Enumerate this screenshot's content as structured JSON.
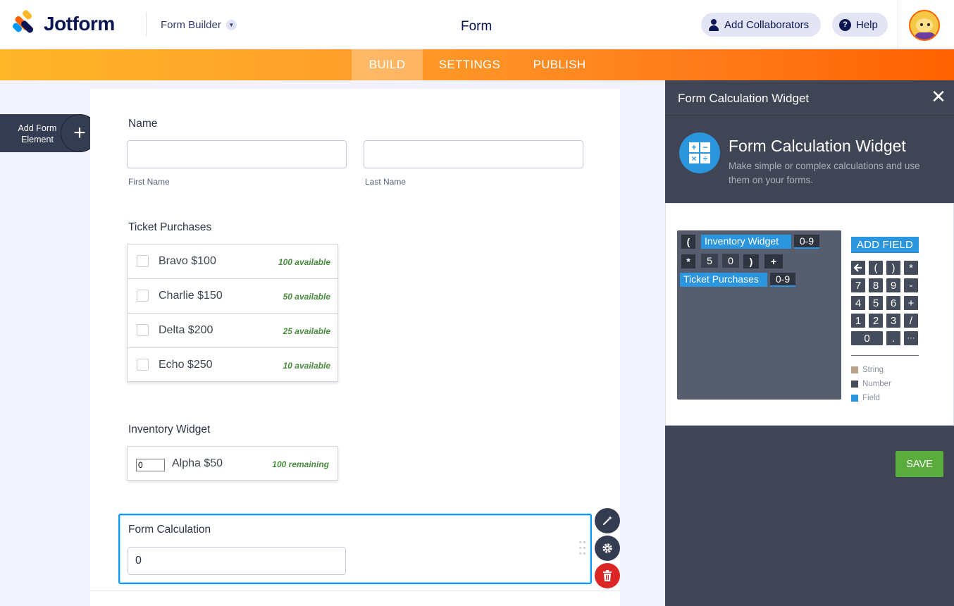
{
  "header": {
    "brand": "Jotform",
    "builder_label": "Form Builder",
    "form_title": "Form",
    "collaborators_label": "Add Collaborators",
    "help_label": "Help"
  },
  "nav": {
    "tabs": [
      {
        "label": "BUILD",
        "active": true
      },
      {
        "label": "SETTINGS",
        "active": false
      },
      {
        "label": "PUBLISH",
        "active": false
      }
    ]
  },
  "add_element": {
    "label_line1": "Add Form",
    "label_line2": "Element"
  },
  "form": {
    "name_label": "Name",
    "first_name_sublabel": "First Name",
    "last_name_sublabel": "Last Name",
    "tickets_label": "Ticket Purchases",
    "tickets": [
      {
        "name": "Bravo $100",
        "availability": "100 available"
      },
      {
        "name": "Charlie $150",
        "availability": "50 available"
      },
      {
        "name": "Delta $200",
        "availability": "25 available"
      },
      {
        "name": "Echo $250",
        "availability": "10 available"
      }
    ],
    "inventory_label": "Inventory Widget",
    "inventory_item": {
      "quantity": "0",
      "name": "Alpha $50",
      "availability": "100 remaining"
    },
    "calculation_label": "Form Calculation",
    "calculation_value": "0"
  },
  "panel": {
    "header_title": "Form Calculation Widget",
    "widget_title": "Form Calculation Widget",
    "widget_description": "Make simple or complex calculations and use them on your forms.",
    "formula_tokens": {
      "open_paren": "(",
      "field1": "Inventory Widget",
      "range1": "0-9",
      "multiply": "*",
      "digit5": "5",
      "digit0": "0",
      "close_paren": ")",
      "plus": "+",
      "field2": "Ticket Purchases",
      "range2": "0-9"
    },
    "add_field_label": "ADD FIELD",
    "keypad": [
      "←",
      "(",
      ")",
      "*",
      "7",
      "8",
      "9",
      "-",
      "4",
      "5",
      "6",
      "+",
      "1",
      "2",
      "3",
      "/",
      "0",
      ".",
      "···"
    ],
    "legend": [
      {
        "label": "String",
        "color": "#b8a28c"
      },
      {
        "label": "Number",
        "color": "#454c5b"
      },
      {
        "label": "Field",
        "color": "#2b95dd"
      }
    ],
    "save_label": "SAVE"
  },
  "colors": {
    "accent_orange": "#ff6100",
    "accent_blue": "#0099ff",
    "save_green": "#5aac3d",
    "delete_red": "#dc2626"
  }
}
